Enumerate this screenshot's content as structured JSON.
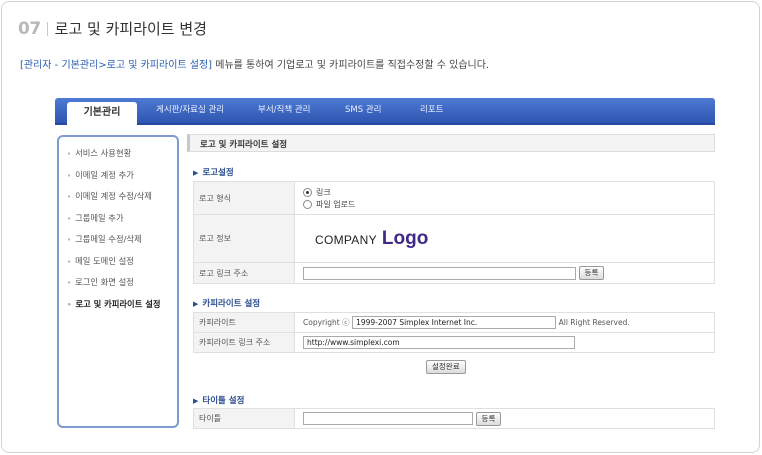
{
  "header": {
    "number": "07",
    "title": "로고 및 카피라이트 변경"
  },
  "description": {
    "path": "[관리자 - 기본관리>로고 및 카피라이트 설정]",
    "text": " 메뉴를 통하여 기업로고 및 카피라이트를 직접수정할 수 있습니다."
  },
  "nav": {
    "tabs": [
      {
        "label": "기본관리",
        "active": true
      },
      {
        "label": "게시판/자료실 관리",
        "active": false
      },
      {
        "label": "부서/직책 관리",
        "active": false
      },
      {
        "label": "SMS 관리",
        "active": false
      },
      {
        "label": "리포트",
        "active": false
      }
    ],
    "colors": {
      "bar": "#3a63c0",
      "active_tab": "#ffffff"
    }
  },
  "sidebar": {
    "items": [
      {
        "label": "서비스 사용현황",
        "active": false
      },
      {
        "label": "이메일 계정 추가",
        "active": false
      },
      {
        "label": "이메일 계정 수정/삭제",
        "active": false
      },
      {
        "label": "그룹메일 추가",
        "active": false
      },
      {
        "label": "그룹메일 수정/삭제",
        "active": false
      },
      {
        "label": "메일 도메인 설정",
        "active": false
      },
      {
        "label": "로그인 화면 설정",
        "active": false
      },
      {
        "label": "로고 및 카피라이트 설정",
        "active": true
      }
    ]
  },
  "panel": {
    "title": "로고 및 카피라이트 설정"
  },
  "logo_section": {
    "title": "로고설정",
    "format_label": "로고 형식",
    "radio_options": [
      {
        "label": "링크",
        "checked": true
      },
      {
        "label": "파일 업로드",
        "checked": false
      }
    ],
    "info_label": "로고 정보",
    "logo_company": "COMPANY",
    "logo_word": "Logo",
    "link_label": "로고 링크 주소",
    "link_value": "",
    "register_button": "등록"
  },
  "copyright_section": {
    "title": "카피라이트 설정",
    "copyright_label": "카피라이트",
    "copyright_prefix": "Copyright ⓒ",
    "copyright_value": "1999-2007 Simplex Internet Inc.",
    "copyright_suffix": "All Right Reserved.",
    "link_label": "카피라이트 링크 주소",
    "link_value": "http://www.simplexi.com",
    "save_button": "설정완료"
  },
  "title_section": {
    "title": "타이틀 설정",
    "title_label": "타이틀",
    "title_value": "",
    "register_button": "등록"
  }
}
